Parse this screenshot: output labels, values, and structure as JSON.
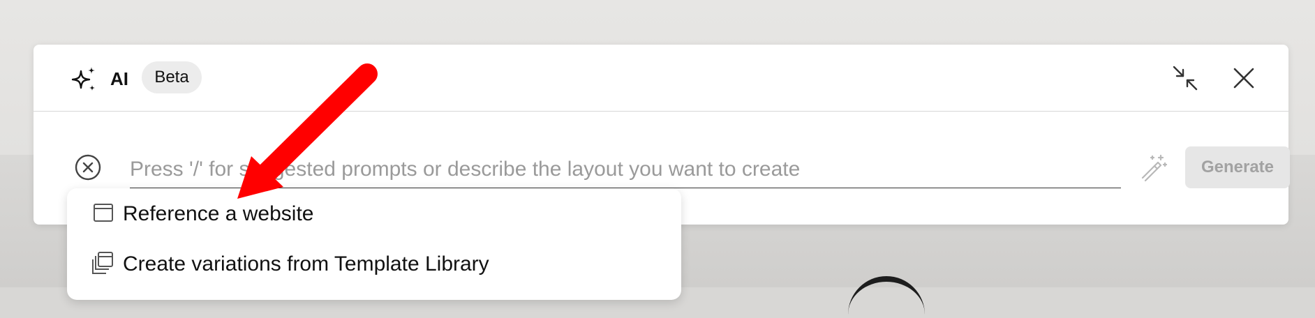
{
  "panel": {
    "title": "AI",
    "badge": "Beta",
    "icons": {
      "title": "sparkle-icon",
      "collapse": "collapse-icon",
      "close": "close-icon",
      "clear": "clear-circle-icon",
      "enhance": "magic-wand-icon"
    }
  },
  "prompt": {
    "placeholder": "Press '/' for suggested prompts or describe the layout you want to create",
    "value": ""
  },
  "generate": {
    "label": "Generate"
  },
  "suggestions": {
    "items": [
      {
        "label": "Reference a website",
        "icon": "browser-window-icon"
      },
      {
        "label": "Create variations from Template Library",
        "icon": "template-stack-icon"
      }
    ]
  },
  "colors": {
    "annotation_arrow": "#ff0000",
    "button_disabled_bg": "#e6e6e6",
    "button_disabled_text": "#a2a2a2"
  }
}
